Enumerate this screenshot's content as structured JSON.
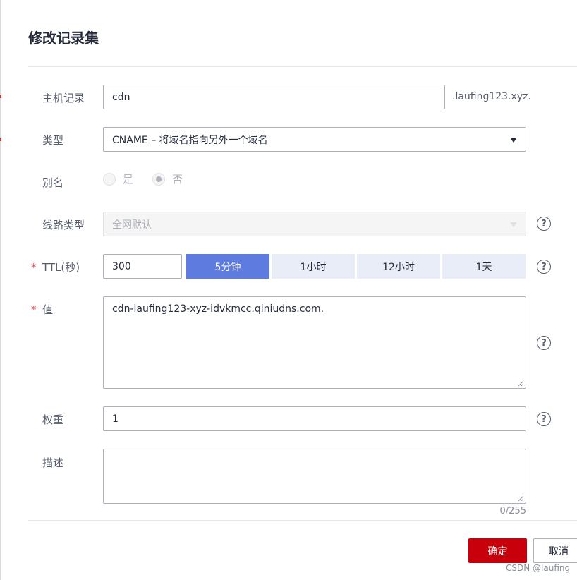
{
  "dialog": {
    "title": "修改记录集"
  },
  "host": {
    "label": "主机记录",
    "value": "cdn",
    "suffix": ".laufing123.xyz."
  },
  "type": {
    "label": "类型",
    "value": "CNAME – 将域名指向另外一个域名"
  },
  "alias": {
    "label": "别名",
    "options": [
      "是",
      "否"
    ],
    "selected": "否"
  },
  "line": {
    "label": "线路类型",
    "value": "全网默认"
  },
  "ttl": {
    "required_mark": "*",
    "label": "TTL(秒)",
    "value": "300",
    "presets": [
      "5分钟",
      "1小时",
      "12小时",
      "1天"
    ],
    "active_preset": "5分钟"
  },
  "value_field": {
    "required_mark": "*",
    "label": "值",
    "value": "cdn-laufing123-xyz-idvkmcc.qiniudns.com."
  },
  "weight": {
    "label": "权重",
    "value": "1"
  },
  "description": {
    "label": "描述",
    "value": "",
    "counter": "0/255"
  },
  "help_icon": "?",
  "footer": {
    "confirm_label": "确定",
    "cancel_label": "取消"
  },
  "watermark": "CSDN @laufing",
  "colors": {
    "primary_button": "#c7000b",
    "ttl_active": "#5e7ce0",
    "ttl_inactive": "#e8edf8",
    "required": "#e54545"
  }
}
